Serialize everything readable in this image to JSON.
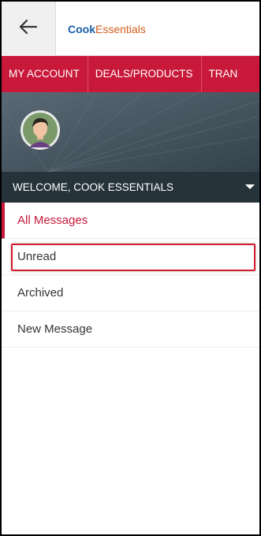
{
  "header": {
    "back_icon": "arrow-left-icon",
    "logo_part1": "Cook",
    "logo_part2": "Essentials"
  },
  "nav": {
    "items": [
      {
        "label": "MY ACCOUNT"
      },
      {
        "label": "DEALS/PRODUCTS"
      },
      {
        "label": "TRAN"
      }
    ]
  },
  "profile": {
    "avatar_icon": "user-avatar-icon",
    "welcome_text": "WELCOME, COOK ESSENTIALS",
    "caret_icon": "chevron-down-icon"
  },
  "menu": {
    "items": [
      {
        "label": "All Messages"
      },
      {
        "label": "Unread"
      },
      {
        "label": "Archived"
      },
      {
        "label": "New Message"
      }
    ]
  },
  "colors": {
    "brand_red": "#c8193a",
    "logo_blue": "#1a5fa8",
    "logo_orange": "#d25c1c",
    "profile_bg": "#3d4b55",
    "welcome_bg": "#26333b"
  }
}
